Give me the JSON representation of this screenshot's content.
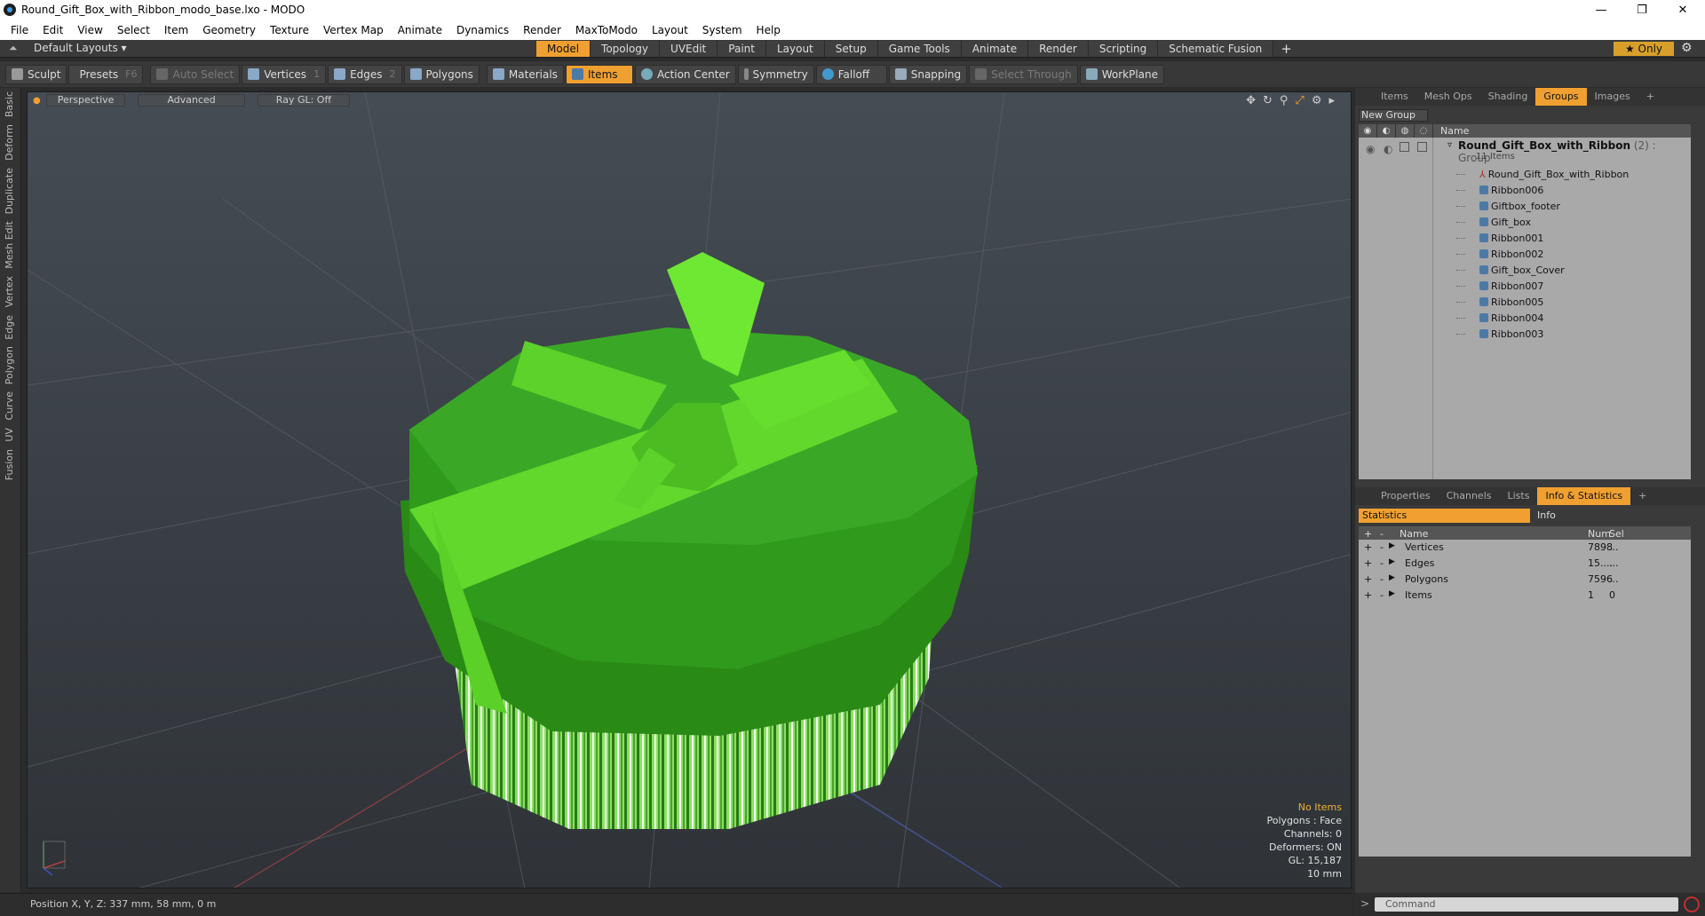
{
  "window": {
    "title": "Round_Gift_Box_with_Ribbon_modo_base.lxo - MODO"
  },
  "menu": [
    "File",
    "Edit",
    "View",
    "Select",
    "Item",
    "Geometry",
    "Texture",
    "Vertex Map",
    "Animate",
    "Dynamics",
    "Render",
    "MaxToModo",
    "Layout",
    "System",
    "Help"
  ],
  "layout": {
    "default_layouts": "Default Layouts ▾",
    "tabs": [
      "Model",
      "Topology",
      "UVEdit",
      "Paint",
      "Layout",
      "Setup",
      "Game Tools",
      "Animate",
      "Render",
      "Scripting",
      "Schematic Fusion"
    ],
    "active_tab": "Model",
    "only": "★ Only"
  },
  "toolbar": {
    "sculpt": "Sculpt",
    "presets": "Presets",
    "presets_key": "F6",
    "auto_select": "Auto Select",
    "vertices": "Vertices",
    "vertices_key": "1",
    "edges": "Edges",
    "edges_key": "2",
    "polygons": "Polygons",
    "materials": "Materials",
    "items": "Items",
    "action_center": "Action Center",
    "symmetry": "Symmetry",
    "falloff": "Falloff",
    "snapping": "Snapping",
    "select_through": "Select Through",
    "workplane": "WorkPlane"
  },
  "left_tabs": [
    "Basic",
    "Deform",
    "Duplicate",
    "Mesh Edit",
    "Vertex",
    "Edge",
    "Polygon",
    "Curve",
    "UV",
    "Fusion"
  ],
  "viewport": {
    "perspective": "Perspective",
    "advanced": "Advanced",
    "raygl": "Ray GL: Off",
    "info": {
      "no_items": "No Items",
      "polygons": "Polygons : Face",
      "channels": "Channels: 0",
      "deformers": "Deformers: ON",
      "gl": "GL: 15,187",
      "scale": "10 mm"
    }
  },
  "status": {
    "position": "Position X, Y, Z:  337 mm, 58 mm, 0 m"
  },
  "groups_panel": {
    "tabs": [
      "Items",
      "Mesh Ops",
      "Shading",
      "Groups",
      "Images"
    ],
    "active": "Groups",
    "new_group": "New Group",
    "name_header": "Name",
    "group_name": "Round_Gift_Box_with_Ribbon",
    "group_suffix": " (2) : Group",
    "group_count": "11 Items",
    "items": [
      "Round_Gift_Box_with_Ribbon",
      "Ribbon006",
      "Giftbox_footer",
      "Gift_box",
      "Ribbon001",
      "Ribbon002",
      "Gift_box_Cover",
      "Ribbon007",
      "Ribbon005",
      "Ribbon004",
      "Ribbon003"
    ]
  },
  "info_panel": {
    "tabs": [
      "Properties",
      "Channels",
      "Lists",
      "Info & Statistics"
    ],
    "active": "Info & Statistics",
    "statistics": "Statistics",
    "info": "Info",
    "headers": {
      "name": "Name",
      "num": "Num",
      "sel": "Sel"
    },
    "rows": [
      {
        "name": "Vertices",
        "num": "7898",
        "sel": "..."
      },
      {
        "name": "Edges",
        "num": "15....",
        "sel": "..."
      },
      {
        "name": "Polygons",
        "num": "7596",
        "sel": "..."
      },
      {
        "name": "Items",
        "num": "1",
        "sel": "0"
      }
    ]
  },
  "command": {
    "placeholder": "Command"
  },
  "colors": {
    "accent": "#f0a030",
    "box_green": "#2f8a1a",
    "ribbon_green": "#5fd62a"
  }
}
